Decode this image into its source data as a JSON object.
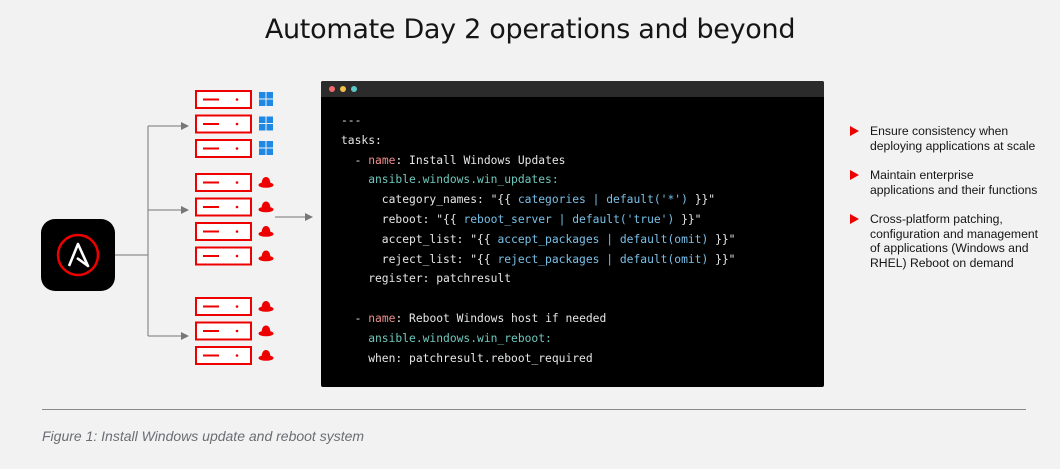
{
  "title": "Automate Day 2 operations and beyond",
  "caption": "Figure 1: Install Windows update and reboot system",
  "colors": {
    "accent_red": "#ee0000",
    "code_key": "#f08c8c",
    "code_var": "#79c0e8",
    "code_module": "#6fc7bd",
    "windows_blue": "#1e88e5",
    "window_dots": [
      "#f26b6b",
      "#f5c04a",
      "#5bc8c8"
    ]
  },
  "icons": {
    "logo": "ansible-logo-icon",
    "server": "server-icon",
    "windows": "windows-icon",
    "redhat": "red-hat-icon"
  },
  "server_groups": [
    {
      "os": "windows",
      "count": 3
    },
    {
      "os": "redhat",
      "count": 4
    },
    {
      "os": "redhat",
      "count": 3
    }
  ],
  "code_lines": [
    [
      {
        "t": "---",
        "c": "plain"
      }
    ],
    [
      {
        "t": "tasks:",
        "c": "plain"
      }
    ],
    [
      {
        "t": "  - ",
        "c": "plain"
      },
      {
        "t": "name",
        "c": "key"
      },
      {
        "t": ": Install Windows Updates",
        "c": "plain"
      }
    ],
    [
      {
        "t": "    ansible.windows.win_updates:",
        "c": "mod"
      }
    ],
    [
      {
        "t": "      category_names: \"{{ ",
        "c": "plain"
      },
      {
        "t": "categories | default('*')",
        "c": "var"
      },
      {
        "t": " }}\"",
        "c": "plain"
      }
    ],
    [
      {
        "t": "      reboot: \"{{ ",
        "c": "plain"
      },
      {
        "t": "reboot_server | default('true')",
        "c": "var"
      },
      {
        "t": " }}\"",
        "c": "plain"
      }
    ],
    [
      {
        "t": "      accept_list: \"{{ ",
        "c": "plain"
      },
      {
        "t": "accept_packages | default(omit)",
        "c": "var"
      },
      {
        "t": " }}\"",
        "c": "plain"
      }
    ],
    [
      {
        "t": "      reject_list: \"{{ ",
        "c": "plain"
      },
      {
        "t": "reject_packages | default(omit)",
        "c": "var"
      },
      {
        "t": " }}\"",
        "c": "plain"
      }
    ],
    [
      {
        "t": "    register: patchresult",
        "c": "plain"
      }
    ],
    [
      {
        "t": "",
        "c": "plain"
      }
    ],
    [
      {
        "t": "  - ",
        "c": "plain"
      },
      {
        "t": "name",
        "c": "key"
      },
      {
        "t": ": Reboot Windows host if needed",
        "c": "plain"
      }
    ],
    [
      {
        "t": "    ansible.windows.win_reboot:",
        "c": "mod"
      }
    ],
    [
      {
        "t": "    when: patchresult.reboot_required",
        "c": "plain"
      }
    ]
  ],
  "bullets": [
    "Ensure consistency when deploying applications at scale",
    "Maintain enterprise applications and their functions",
    "Cross-platform patching, configuration and management of applications (Windows and RHEL) Reboot on demand"
  ]
}
